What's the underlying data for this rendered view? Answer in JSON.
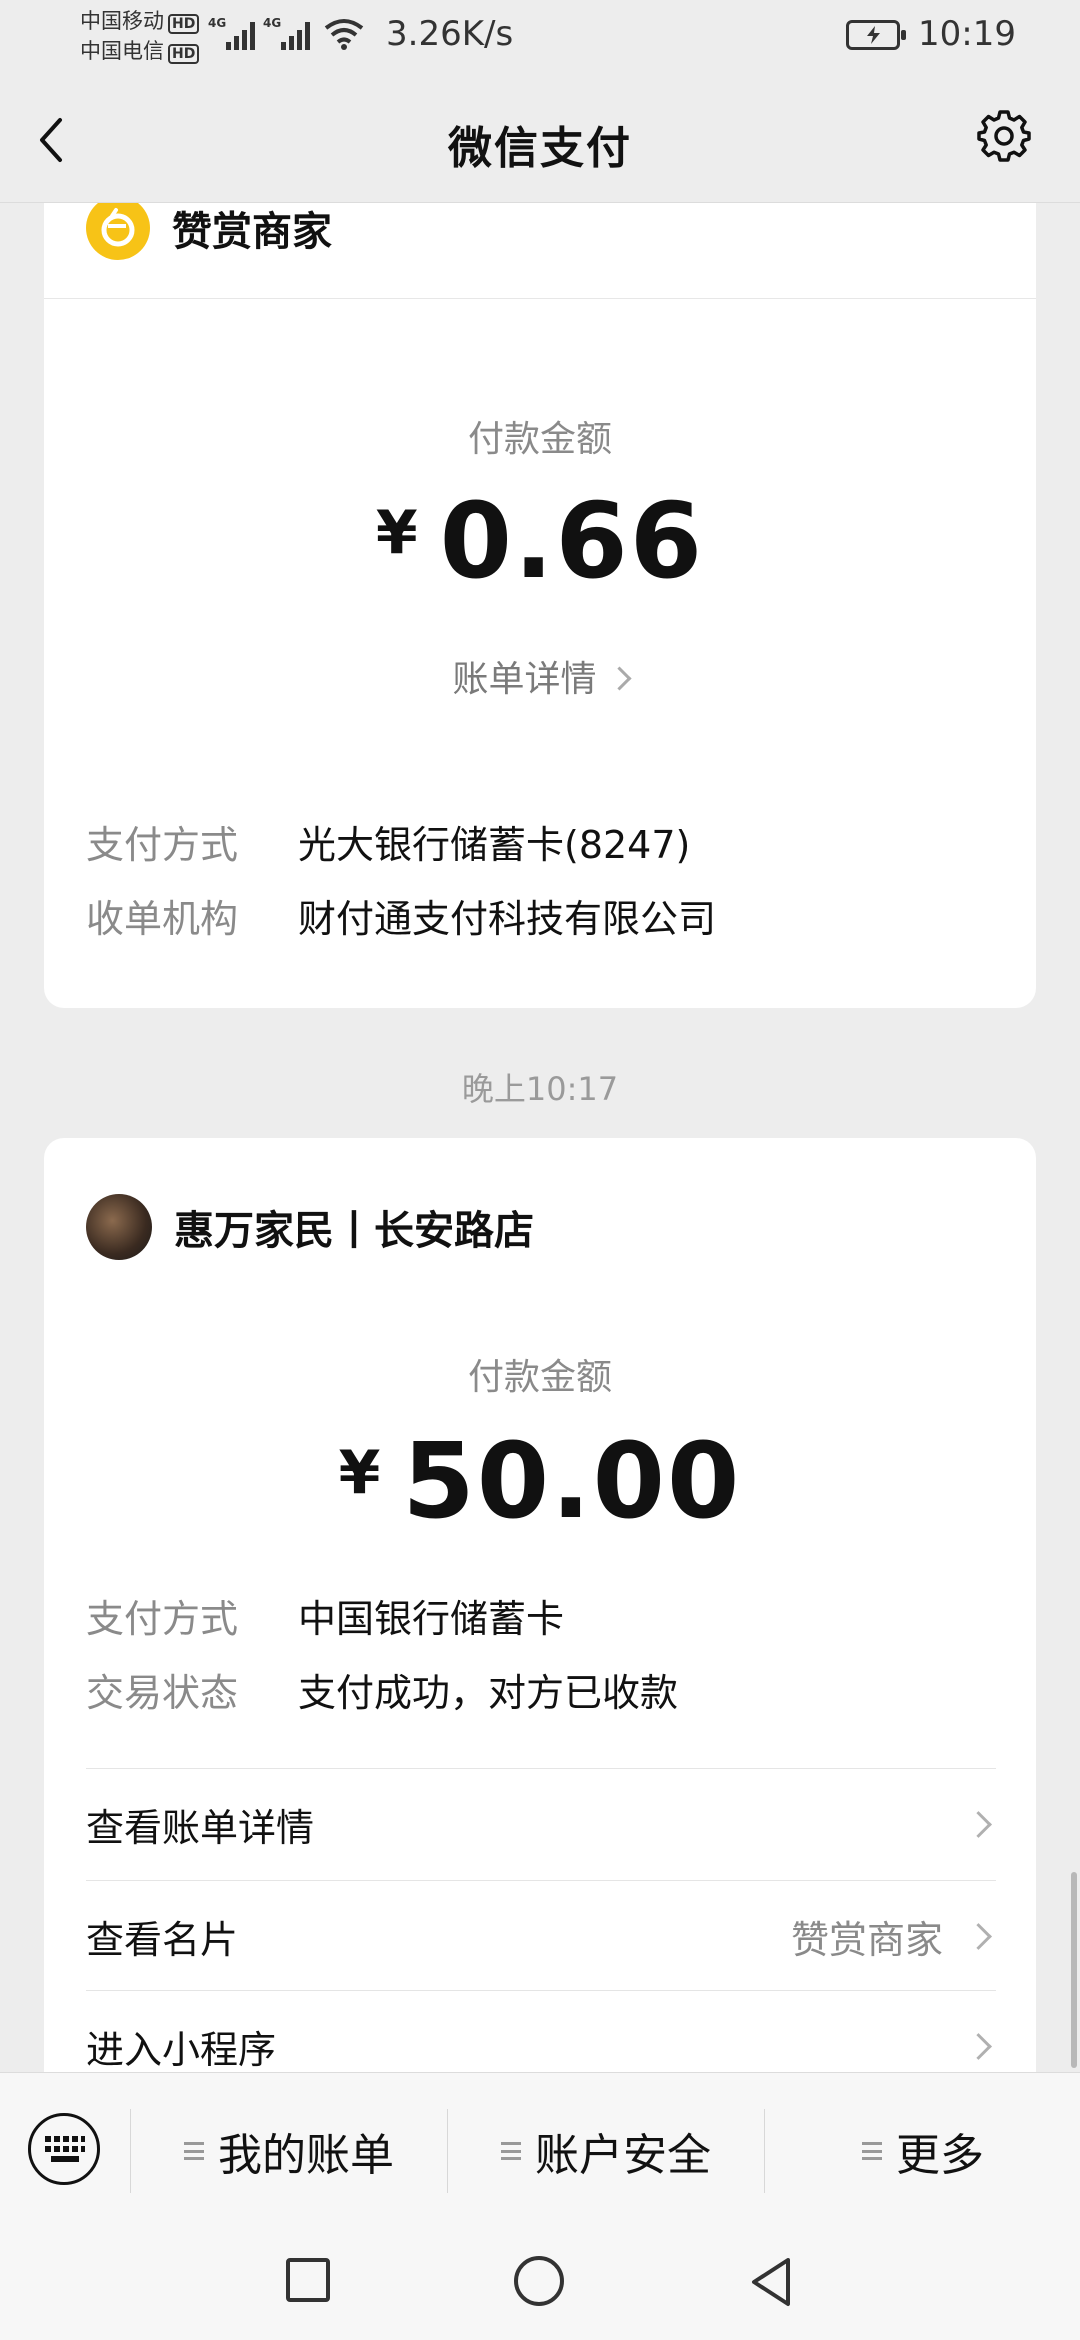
{
  "status_bar": {
    "carrier_1": "中国移动",
    "carrier_2": "中国电信",
    "hd_badge": "HD",
    "network_1": "4G",
    "network_2": "4G",
    "speed": "3.26K/s",
    "time": "10:19"
  },
  "nav": {
    "title": "微信支付"
  },
  "card1": {
    "merchant": "赞赏商家",
    "amount_label": "付款金额",
    "currency": "¥",
    "amount": "0.66",
    "bill_link": "账单详情",
    "details": [
      {
        "key": "支付方式",
        "value": "光大银行储蓄卡(8247)"
      },
      {
        "key": "收单机构",
        "value": "财付通支付科技有限公司"
      }
    ]
  },
  "timestamp": "晚上10:17",
  "card2": {
    "merchant": "惠万家民丨长安路店",
    "amount_label": "付款金额",
    "currency": "¥",
    "amount": "50.00",
    "details": [
      {
        "key": "支付方式",
        "value": "中国银行储蓄卡"
      },
      {
        "key": "交易状态",
        "value": "支付成功，对方已收款"
      }
    ],
    "rows": [
      {
        "label": "查看账单详情",
        "value": ""
      },
      {
        "label": "查看名片",
        "value": "赞赏商家"
      },
      {
        "label": "进入小程序",
        "value": ""
      }
    ]
  },
  "toolbar": {
    "items": [
      "我的账单",
      "账户安全",
      "更多"
    ]
  }
}
